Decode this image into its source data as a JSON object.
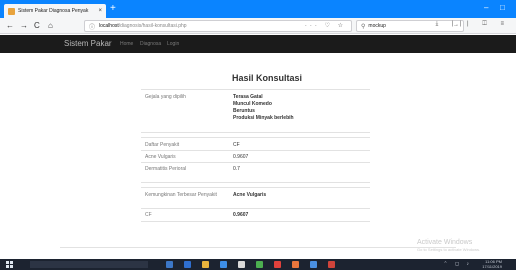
{
  "browser": {
    "tab_title": "Sistem Pakar Diagnosa Penyak",
    "close_glyph": "×",
    "new_tab_glyph": "+",
    "window_controls": [
      "–",
      "□"
    ],
    "nav": {
      "back": "←",
      "forward": "→",
      "reload": "C",
      "home": "⌂"
    },
    "url_host": "localhost",
    "url_path": "/diagnosis/hasil-konsultasi.php",
    "url_icons": "··· ♡ ☆",
    "search_value": "mockup",
    "search_go": "→",
    "toolbar_icons": "⤓ ||| ◫ ≡"
  },
  "app": {
    "brand": "Sistem Pakar",
    "menu": [
      "Home",
      "Diagnosa",
      "Login"
    ]
  },
  "result": {
    "heading": "Hasil Konsultasi",
    "gejala_label": "Gejala yang dipilih",
    "gejala": [
      "Terasa Gatal",
      "Muncul Komedo",
      "Beruntus",
      "Produksi Minyak berlebih"
    ],
    "penyakit_header_label": "Daftar Penyakit",
    "penyakit_header_value": "CF",
    "penyakit": [
      {
        "name": "Acne Vulgaris",
        "cf": "0.9607"
      },
      {
        "name": "Dermatitis Perioral",
        "cf": "0.7"
      }
    ],
    "kemungkinan_label": "Kemungkinan Terbesar Penyakit",
    "kemungkinan_value": "Acne Vulgaris",
    "cf_label": "CF",
    "cf_value": "0.9607"
  },
  "watermark": {
    "title": "Activate Windows",
    "subtitle": "Go to Settings to activate Windows."
  },
  "taskbar": {
    "clock": "11:06 PM",
    "date": "17/11/2019",
    "sys_icons": "⌃ ◻ ♪"
  },
  "colors": {
    "tabbar": "#0a84ff",
    "app_nav": "#1b1b1b",
    "taskbar": "#1c2330"
  }
}
